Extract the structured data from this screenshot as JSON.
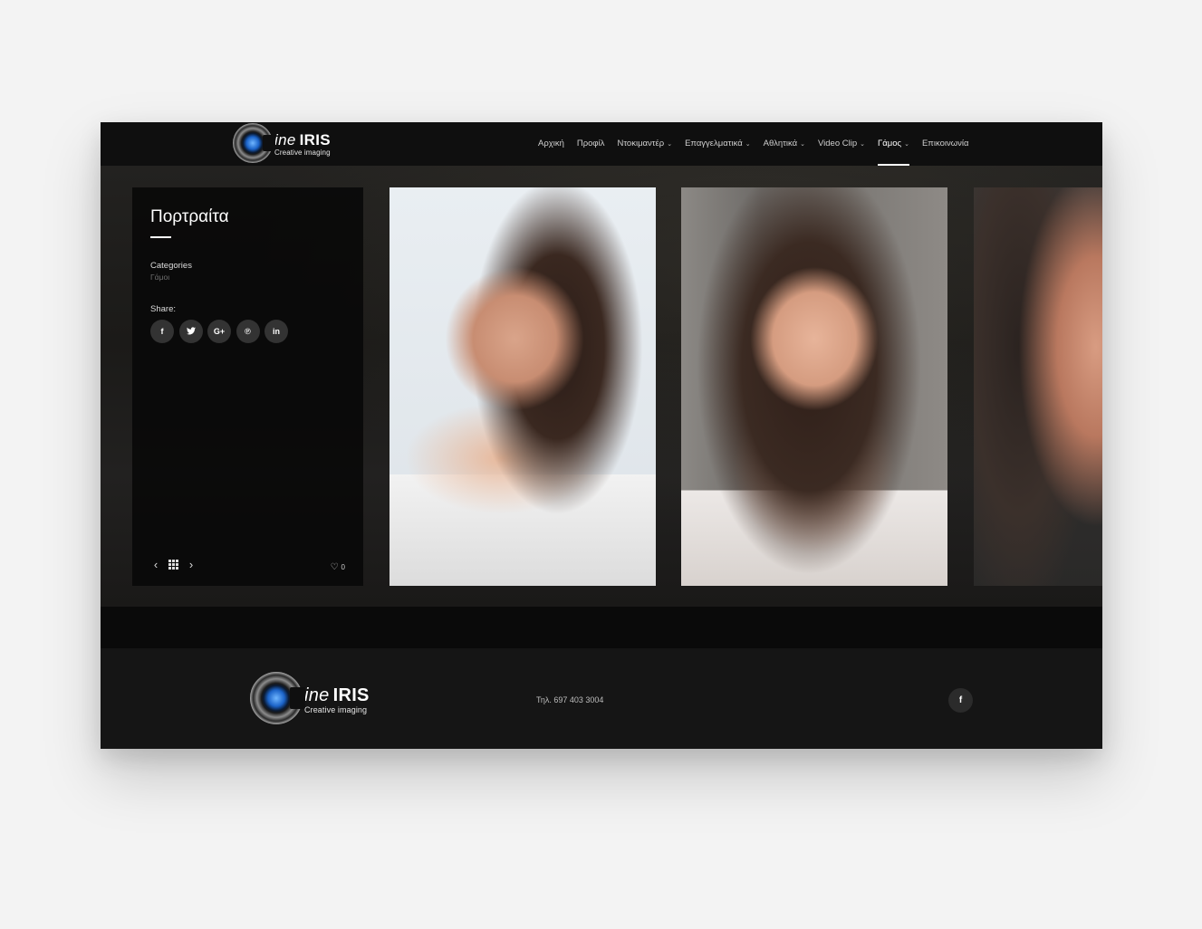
{
  "brand": {
    "logo_main_prefix": "ine",
    "logo_main": "IRIS",
    "logo_sub": "Creative imaging"
  },
  "nav": {
    "items": [
      {
        "label": "Αρχική",
        "dropdown": false
      },
      {
        "label": "Προφίλ",
        "dropdown": false
      },
      {
        "label": "Ντοκιμαντέρ",
        "dropdown": true
      },
      {
        "label": "Επαγγελματικά",
        "dropdown": true
      },
      {
        "label": "Αθλητικά",
        "dropdown": true
      },
      {
        "label": "Video Clip",
        "dropdown": true
      },
      {
        "label": "Γάμος",
        "dropdown": true,
        "active": true
      },
      {
        "label": "Επικοινωνία",
        "dropdown": false
      }
    ],
    "chevron_icon": "chevron-down-icon"
  },
  "portfolio": {
    "title": "Πορτραίτα",
    "categories_label": "Categories",
    "category_value": "Γάμοι",
    "share_label": "Share:",
    "share_buttons": [
      {
        "icon": "facebook-icon",
        "glyph": "f"
      },
      {
        "icon": "twitter-icon",
        "glyph": "t"
      },
      {
        "icon": "google-plus-icon",
        "glyph": "G+"
      },
      {
        "icon": "pinterest-icon",
        "glyph": "℗"
      },
      {
        "icon": "linkedin-icon",
        "glyph": "in"
      }
    ],
    "likes_count": "0",
    "prev_glyph": "‹",
    "next_glyph": "›",
    "heart_glyph": "♡"
  },
  "footer": {
    "phone": "Τηλ. 697 403 3004",
    "facebook_glyph": "f"
  },
  "colors": {
    "page_bg": "#f3f3f3",
    "site_bg": "#111111",
    "accent": "#ffffff",
    "button_bg": "#333333"
  }
}
